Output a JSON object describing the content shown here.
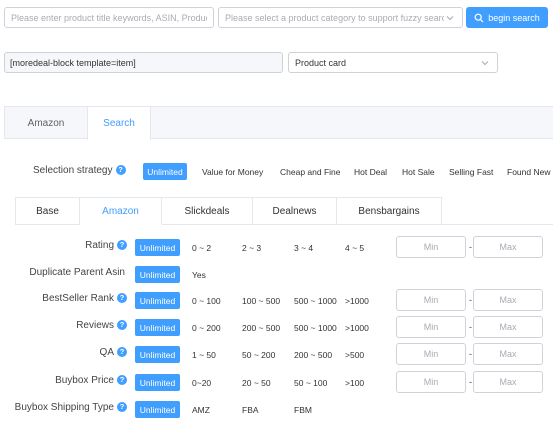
{
  "search_bar": {
    "keyword_placeholder": "Please enter product title keywords, ASIN, Product de",
    "category_placeholder": "Please select a product category to support fuzzy search",
    "button_label": "begin search"
  },
  "template": {
    "shortcode": "[moredeal-block template=item]",
    "card_type": "Product card"
  },
  "outer_tabs": [
    {
      "label": "Amazon",
      "active": false
    },
    {
      "label": "Search",
      "active": true
    }
  ],
  "strategy": {
    "label": "Selection strategy",
    "selected": "Unlimited",
    "options": [
      "Value for Money",
      "Cheap and Fine",
      "Hot Deal",
      "Hot Sale",
      "Selling Fast",
      "Found New"
    ]
  },
  "inner_tabs": [
    {
      "label": "Base",
      "active": false
    },
    {
      "label": "Amazon",
      "active": true
    },
    {
      "label": "Slickdeals",
      "active": false
    },
    {
      "label": "Dealnews",
      "active": false
    },
    {
      "label": "Bensbargains",
      "active": false
    }
  ],
  "filters": [
    {
      "label": "Rating",
      "help": true,
      "selected": "Unlimited",
      "options": [
        "0 ~ 2",
        "2 ~ 3",
        "3 ~ 4",
        "4 ~ 5"
      ],
      "range": true
    },
    {
      "label": "Duplicate Parent Asin",
      "help": false,
      "selected": "Unlimited",
      "options": [
        "Yes"
      ],
      "range": false
    },
    {
      "label": "BestSeller Rank",
      "help": true,
      "selected": "Unlimited",
      "options": [
        "0 ~ 100",
        "100 ~ 500",
        "500 ~ 1000",
        ">1000"
      ],
      "range": true
    },
    {
      "label": "Reviews",
      "help": true,
      "selected": "Unlimited",
      "options": [
        "0 ~ 200",
        "200 ~ 500",
        "500 ~ 1000",
        ">1000"
      ],
      "range": true
    },
    {
      "label": "QA",
      "help": true,
      "selected": "Unlimited",
      "options": [
        "1 ~ 50",
        "50 ~ 200",
        "200 ~ 500",
        ">500"
      ],
      "range": true
    },
    {
      "label": "Buybox Price",
      "help": true,
      "selected": "Unlimited",
      "options": [
        "0~20",
        "20 ~ 50",
        "50 ~ 100",
        ">100"
      ],
      "range": true
    },
    {
      "label": "Buybox Shipping Type",
      "help": true,
      "selected": "Unlimited",
      "options": [
        "AMZ",
        "FBA",
        "FBM"
      ],
      "range": false
    }
  ],
  "range_labels": {
    "min": "Min",
    "max": "Max",
    "separator": "-"
  },
  "help_glyph": "?",
  "colors": {
    "primary": "#409eff",
    "border": "#cfd3d9",
    "tab_bg": "#f5f7fa"
  },
  "icons": {
    "search": "search-icon",
    "dropdown": "chevron-down-icon",
    "help": "question-circle-icon"
  }
}
